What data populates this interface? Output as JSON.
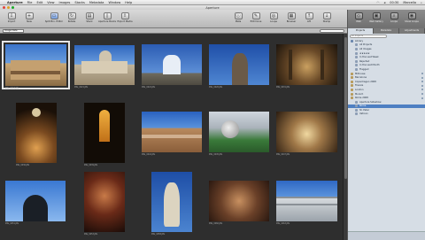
{
  "menubar": {
    "items": [
      "Aperture",
      "File",
      "Edit",
      "View",
      "Images",
      "Stacks",
      "Metadata",
      "Window",
      "Help"
    ],
    "clock": "00:30",
    "user": "Marcello"
  },
  "window": {
    "title": "Aperture"
  },
  "toolbar": {
    "left": [
      "Import",
      "New",
      "Split Bro. Editor",
      "Rotate",
      "Stack",
      "Aperture Books",
      "Export Media"
    ],
    "right": [
      "Meta",
      "Edit Done",
      "Loupe",
      "Browser",
      "Lift",
      "Stamp"
    ]
  },
  "sidebar_toolbar": [
    "Web",
    "Web Gallery",
    "Loupe",
    "Show Loupe",
    "Full Screen"
  ],
  "browser": {
    "sort_label": "Image Date"
  },
  "thumbs": [
    {
      "caption": "IMG_0018.JPG"
    },
    {
      "caption": "IMG_0021.JPG"
    },
    {
      "caption": "IMG_0024.JPG"
    },
    {
      "caption": "IMG_0026.JPG"
    },
    {
      "caption": "IMG_0031.JPG"
    },
    {
      "caption": "IMG_0036.JPG"
    },
    {
      "caption": "IMG_0039.JPG"
    },
    {
      "caption": "IMG_0042.JPG"
    },
    {
      "caption": "IMG_0045.JPG"
    },
    {
      "caption": "IMG_0047.JPG"
    },
    {
      "caption": "IMG_0051.JPG"
    },
    {
      "caption": "IMG_0053.JPG"
    },
    {
      "caption": "IMG_0058.JPG"
    },
    {
      "caption": "IMG_0060.JPG"
    },
    {
      "caption": "IMG_0063.JPG"
    }
  ],
  "sidebar": {
    "tabs": [
      "Projects",
      "Metadata",
      "Adjustments"
    ],
    "filter_placeholder": "All Projects",
    "tree": [
      {
        "label": "Library",
        "indent": 0,
        "color": "#6a86ad"
      },
      {
        "label": "All Projects",
        "indent": 1,
        "color": "#8c9db5"
      },
      {
        "label": "All Images",
        "indent": 1,
        "color": "#8c9db5"
      },
      {
        "label": "★★★★★",
        "indent": 1,
        "color": "#8c9db5"
      },
      {
        "label": "In the Last Week",
        "indent": 1,
        "color": "#8c9db5"
      },
      {
        "label": "Rejected",
        "indent": 1,
        "color": "#8c9db5"
      },
      {
        "label": "In the Last Month",
        "indent": 1,
        "color": "#8c9db5"
      },
      {
        "label": "Flagged",
        "indent": 1,
        "color": "#8c9db5"
      },
      {
        "label": "Milhouse",
        "indent": 0,
        "color": "#b79a5a"
      },
      {
        "label": "Barcelona",
        "indent": 0,
        "color": "#b79a5a"
      },
      {
        "label": "Copenhagen 2008",
        "indent": 0,
        "color": "#b79a5a"
      },
      {
        "label": "Firenze",
        "indent": 0,
        "color": "#b79a5a"
      },
      {
        "label": "London",
        "indent": 0,
        "color": "#b79a5a"
      },
      {
        "label": "Munich",
        "indent": 0,
        "color": "#b79a5a"
      },
      {
        "label": "Rome 2008",
        "indent": 0,
        "color": "#b79a5a"
      },
      {
        "label": "Aperture Sideshow",
        "indent": 1,
        "color": "#8c9db5"
      },
      {
        "label": "Rome",
        "indent": 1,
        "color": "#8c9db5",
        "selected": true
      },
      {
        "label": "St. Peter",
        "indent": 1,
        "color": "#8c9db5"
      },
      {
        "label": "Vatican",
        "indent": 1,
        "color": "#8c9db5"
      }
    ]
  }
}
